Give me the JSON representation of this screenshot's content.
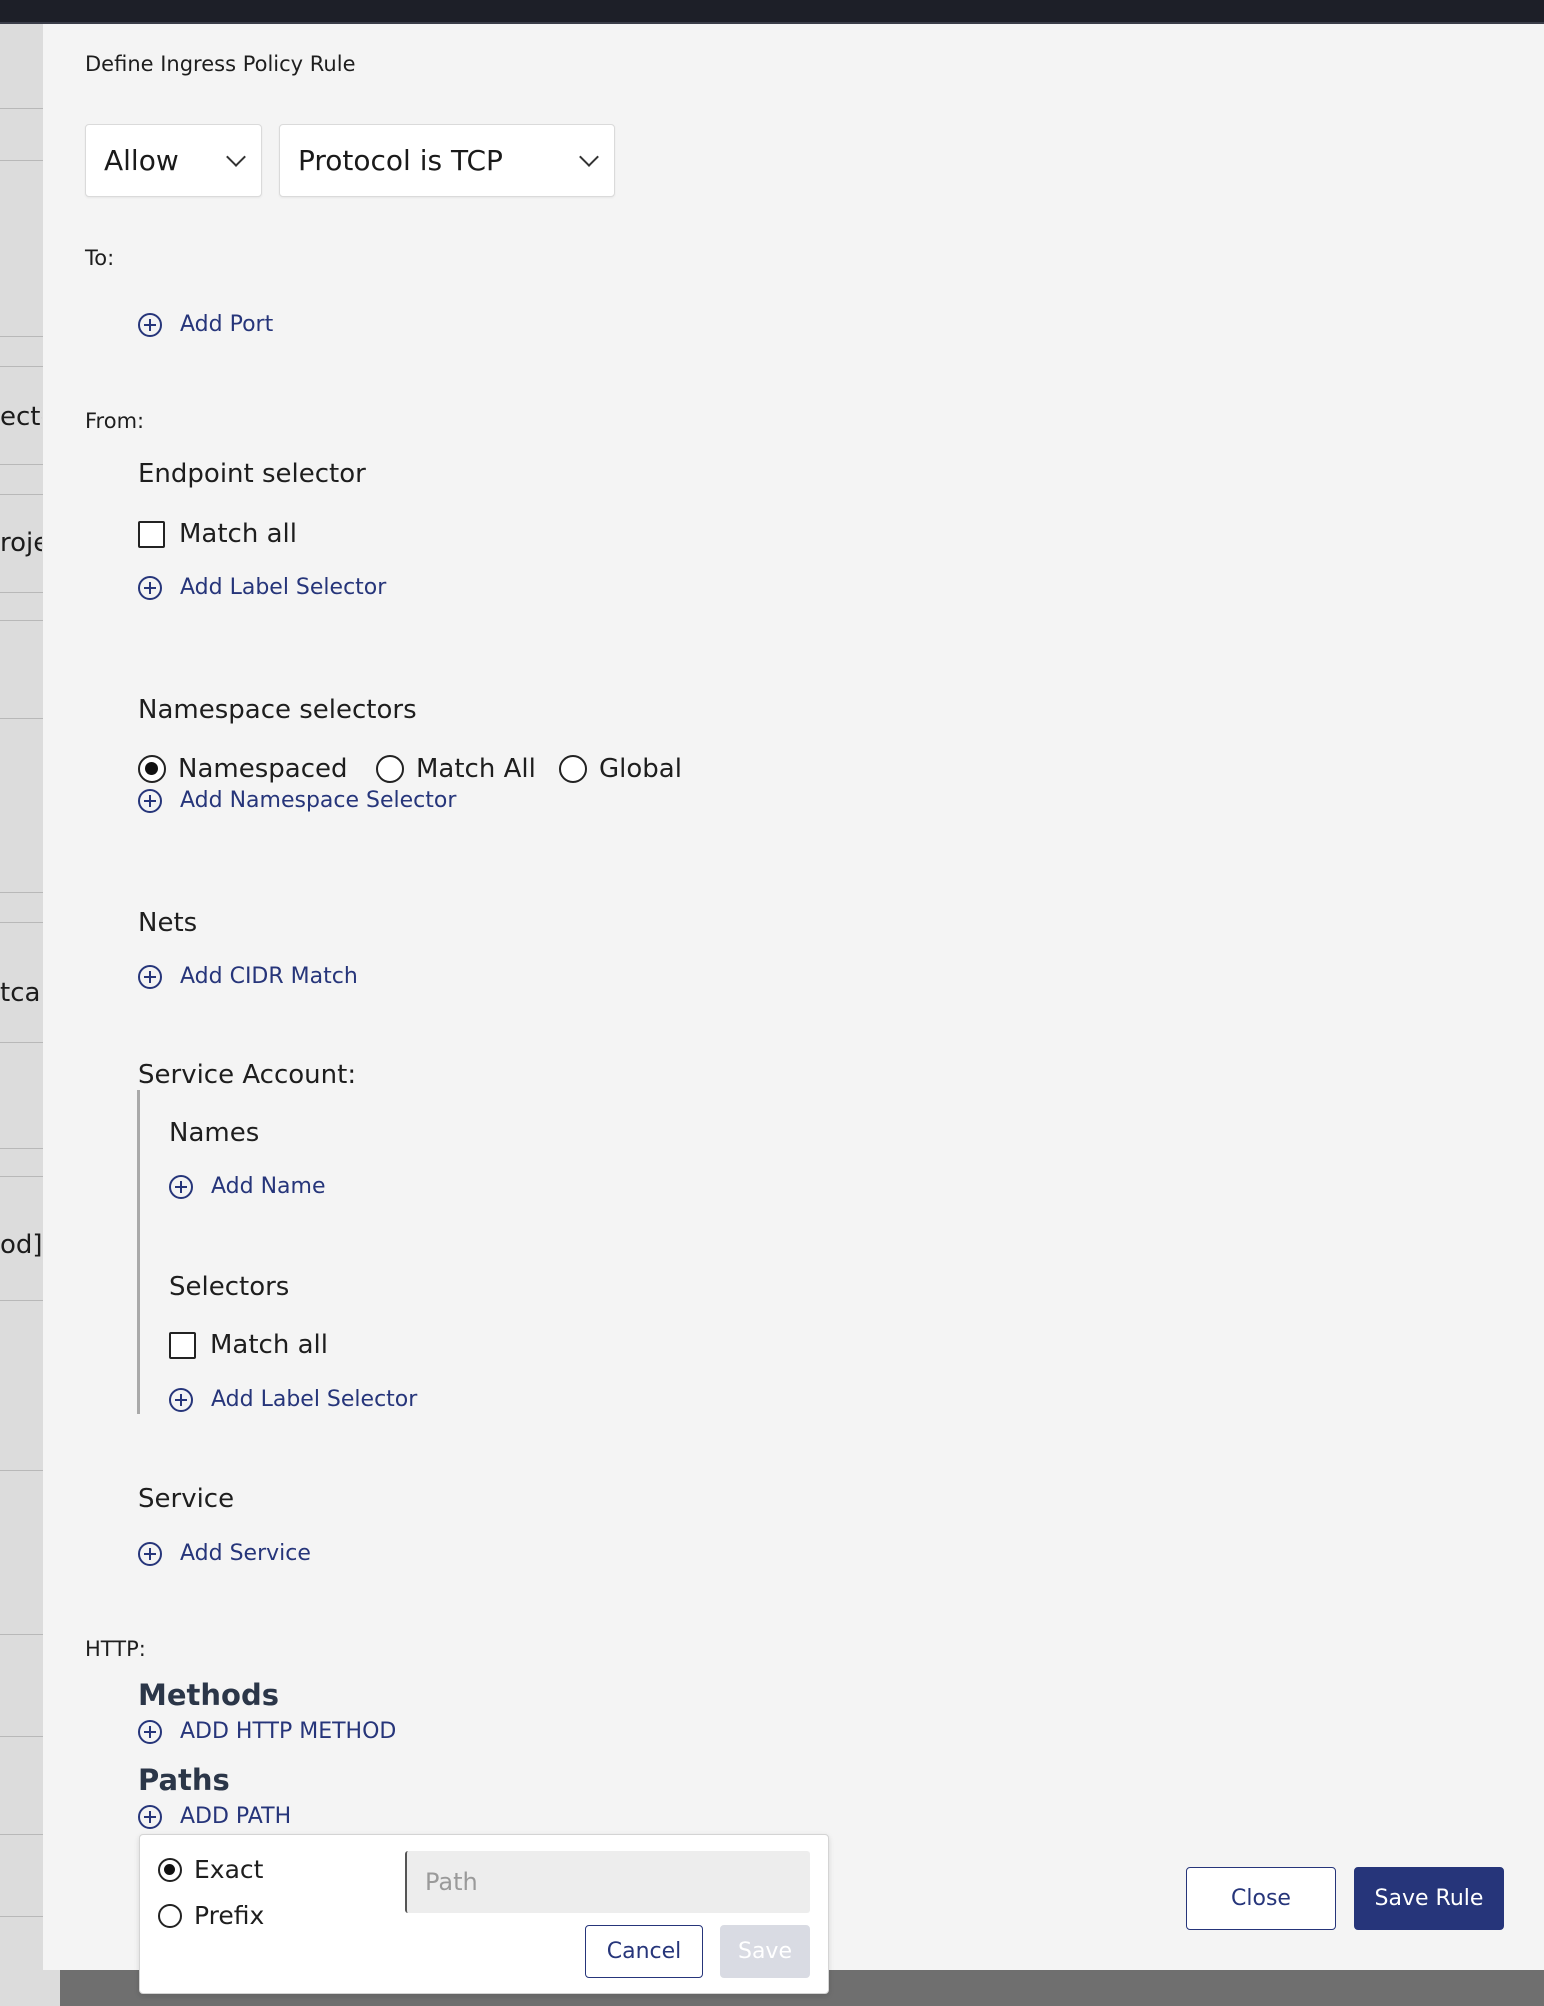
{
  "background": {
    "fragments": [
      "ecto",
      "rojec",
      "tcal",
      "od]]"
    ]
  },
  "modal": {
    "title": "Define Ingress Policy Rule",
    "action_select": "Allow",
    "protocol_select": "Protocol is TCP",
    "to": {
      "label": "To:",
      "add_port": "Add Port"
    },
    "from": {
      "label": "From:",
      "endpoint_selector": {
        "title": "Endpoint selector",
        "match_all": "Match all",
        "add_label_selector": "Add Label Selector"
      },
      "namespace_selectors": {
        "title": "Namespace selectors",
        "options": [
          "Namespaced",
          "Match All",
          "Global"
        ],
        "selected": "Namespaced",
        "add_namespace_selector": "Add Namespace Selector"
      },
      "nets": {
        "title": "Nets",
        "add_cidr_match": "Add CIDR Match"
      },
      "service_account": {
        "title": "Service Account:",
        "names_title": "Names",
        "add_name": "Add Name",
        "selectors_title": "Selectors",
        "match_all": "Match all",
        "add_label_selector": "Add Label Selector"
      },
      "service": {
        "title": "Service",
        "add_service": "Add Service"
      }
    },
    "http": {
      "label": "HTTP:",
      "methods_title": "Methods",
      "add_http_method": "ADD HTTP METHOD",
      "paths_title": "Paths",
      "add_path": "ADD PATH"
    },
    "path_popover": {
      "match_types": [
        "Exact",
        "Prefix"
      ],
      "selected": "Exact",
      "path_placeholder": "Path",
      "path_value": "",
      "cancel": "Cancel",
      "save": "Save"
    },
    "footer": {
      "close": "Close",
      "save_rule": "Save Rule"
    }
  },
  "colors": {
    "accent": "#26357a",
    "modal_bg": "#f4f4f4",
    "topbar": "#1d1f28"
  }
}
